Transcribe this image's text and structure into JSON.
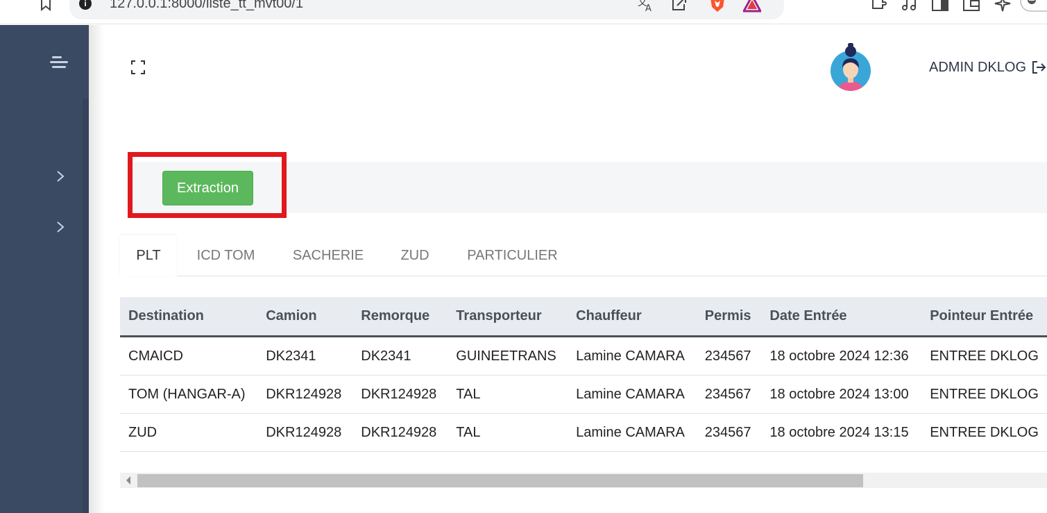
{
  "browser": {
    "url": "127.0.0.1:8000/liste_tt_mvt00/1"
  },
  "header": {
    "user_name": "ADMIN DKLOG"
  },
  "toolbar": {
    "extract_label": "Extraction"
  },
  "tabs": [
    {
      "label": "PLT",
      "active": true
    },
    {
      "label": "ICD TOM",
      "active": false
    },
    {
      "label": "SACHERIE",
      "active": false
    },
    {
      "label": "ZUD",
      "active": false
    },
    {
      "label": "PARTICULIER",
      "active": false
    }
  ],
  "table": {
    "columns": [
      "Destination",
      "Camion",
      "Remorque",
      "Transporteur",
      "Chauffeur",
      "Permis",
      "Date Entrée",
      "Pointeur Entrée"
    ],
    "rows": [
      [
        "CMAICD",
        "DK2341",
        "DK2341",
        "GUINEETRANS",
        "Lamine CAMARA",
        "234567",
        "18 octobre 2024 12:36",
        "ENTREE DKLOG"
      ],
      [
        "TOM (HANGAR-A)",
        "DKR124928",
        "DKR124928",
        "TAL",
        "Lamine CAMARA",
        "234567",
        "18 octobre 2024 13:00",
        "ENTREE DKLOG"
      ],
      [
        "ZUD",
        "DKR124928",
        "DKR124928",
        "TAL",
        "Lamine CAMARA",
        "234567",
        "18 octobre 2024 13:15",
        "ENTREE DKLOG"
      ]
    ]
  },
  "colors": {
    "sidebar": "#3a4a63",
    "extract_button": "#5cb85c",
    "highlight": "#e0191e"
  },
  "icons": {
    "sidebar_toggle": "hamburger-icon",
    "fullscreen": "fullscreen-icon",
    "logout": "logout-icon",
    "sidebar_expand": "chevron-right-icon"
  }
}
